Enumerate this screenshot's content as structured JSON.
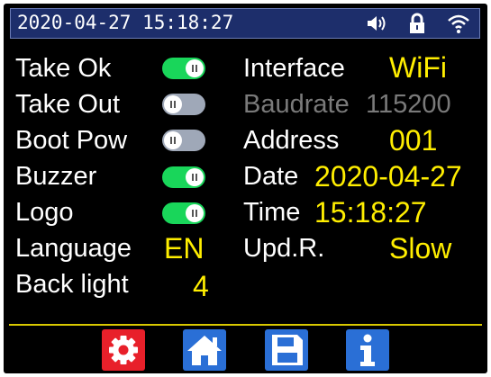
{
  "status_bar": {
    "datetime": "2020-04-27  15:18:27",
    "icons": [
      "speaker-icon",
      "lock-icon",
      "wifi-icon"
    ]
  },
  "left_settings": [
    {
      "label": "Take  Ok",
      "control": "toggle",
      "state": "on"
    },
    {
      "label": "Take  Out",
      "control": "toggle",
      "state": "off"
    },
    {
      "label": "Boot Pow",
      "control": "toggle",
      "state": "off"
    },
    {
      "label": "Buzzer",
      "control": "toggle",
      "state": "on"
    },
    {
      "label": "Logo",
      "control": "toggle",
      "state": "on"
    },
    {
      "label": "Language",
      "value": "EN"
    },
    {
      "label": "Back light",
      "value": "4"
    }
  ],
  "right_settings": [
    {
      "label": "Interface",
      "value": "WiFi"
    },
    {
      "label": "Baudrate",
      "value": "115200",
      "disabled": true
    },
    {
      "label": "Address",
      "value": "001"
    },
    {
      "label": "Date",
      "value": "2020-04-27"
    },
    {
      "label": "Time",
      "value": "15:18:27"
    },
    {
      "label": "Upd.R.",
      "value": "Slow"
    }
  ],
  "nav": [
    {
      "icon": "gear-icon",
      "color": "#e8202a"
    },
    {
      "icon": "home-icon",
      "color": "#2a6fd6"
    },
    {
      "icon": "save-icon",
      "color": "#2a6fd6"
    },
    {
      "icon": "info-icon",
      "color": "#2a6fd6"
    }
  ],
  "colors": {
    "background": "#000000",
    "status_bar": "#1d2e6b",
    "value_text": "#ffee00",
    "toggle_on": "#19d65a",
    "toggle_off": "#9fa8b8",
    "disabled_text": "#7a7a7a"
  }
}
